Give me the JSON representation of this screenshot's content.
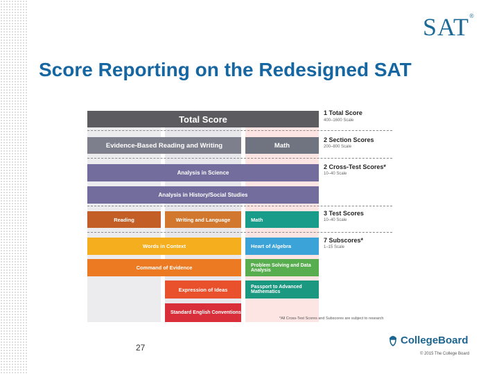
{
  "logo": {
    "text": "SAT",
    "mark": "®"
  },
  "title": "Score Reporting on the Redesigned SAT",
  "bars": {
    "total": "Total Score",
    "ebrw": "Evidence-Based Reading and Writing",
    "math_section": "Math",
    "cross_science": "Analysis in Science",
    "cross_history": "Analysis in History/Social Studies",
    "reading": "Reading",
    "writing": "Writing and Language",
    "math_test": "Math",
    "words_context": "Words in Context",
    "heart_algebra": "Heart of Algebra",
    "command_evidence": "Command of Evidence",
    "problem_solving": "Problem Solving and Data Analysis",
    "expression_ideas": "Expression of Ideas",
    "passport": "Passport to Advanced Mathematics",
    "standard_english": "Standard English Conventions"
  },
  "legend": [
    {
      "title": "1 Total Score",
      "sub": "400–1600 Scale"
    },
    {
      "title": "2 Section Scores",
      "sub": "200–800 Scale"
    },
    {
      "title": "2 Cross-Test Scores*",
      "sub": "10–40 Scale"
    },
    {
      "title": "3 Test Scores",
      "sub": "10–40 Scale"
    },
    {
      "title": "7 Subscores*",
      "sub": "1–15 Scale"
    }
  ],
  "footnote": "*All Cross-Test Scores and Subscores are subject to research",
  "page_number": "27",
  "brand": "CollegeBoard",
  "copyright": "© 2015 The College Board",
  "colors": {
    "title": "#1666a1",
    "total": "#5b5b60",
    "section_ebrw": "#7e7f8c",
    "section_math": "#6f7480",
    "cross": "#726d9d",
    "reading": "#c25e26",
    "writing": "#d1772e",
    "math_test": "#199d8a",
    "yellow": "#f5ae1e",
    "orange": "#ec7a23",
    "red_orange": "#e9502c",
    "red": "#d82f3a",
    "blue": "#3ba3d8",
    "green": "#58ae4e",
    "teal": "#1a9880"
  }
}
